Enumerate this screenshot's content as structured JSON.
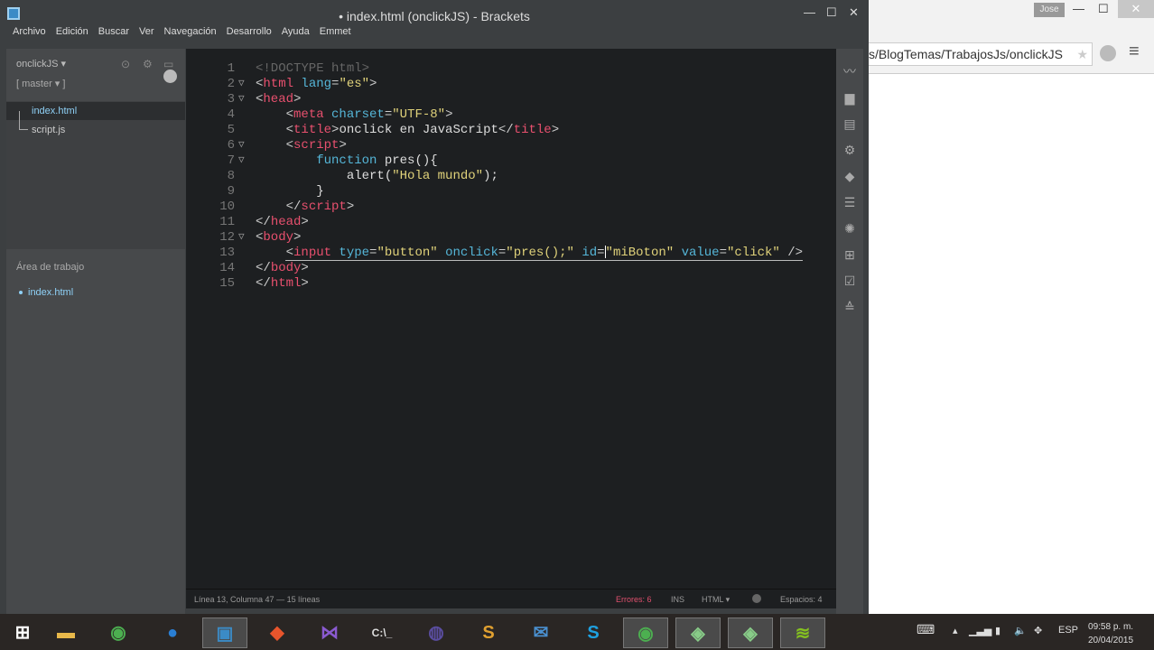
{
  "window": {
    "title": "• index.html (onclickJS) - Brackets",
    "minimize": "—",
    "maximize": "☐",
    "close": "✕"
  },
  "menu": [
    "Archivo",
    "Edición",
    "Buscar",
    "Ver",
    "Navegación",
    "Desarrollo",
    "Ayuda",
    "Emmet"
  ],
  "sidebar": {
    "project": "onclickJS ▾",
    "branch": "[ master ▾ ]",
    "files": [
      "index.html",
      "script.js"
    ],
    "working_set_title": "Área de trabajo",
    "working_set": [
      "index.html"
    ]
  },
  "code": [
    {
      "n": "1",
      "fold": "",
      "t": [
        [
          "com",
          "<!DOCTYPE html>"
        ]
      ]
    },
    {
      "n": "2",
      "fold": "▽",
      "t": [
        [
          "pun",
          "<"
        ],
        [
          "tag",
          "html"
        ],
        [
          "attr",
          " lang"
        ],
        [
          "pun",
          "="
        ],
        [
          "str",
          "\"es\""
        ],
        [
          "pun",
          ">"
        ]
      ]
    },
    {
      "n": "3",
      "fold": "▽",
      "t": [
        [
          "pun",
          "<"
        ],
        [
          "tag",
          "head"
        ],
        [
          "pun",
          ">"
        ]
      ]
    },
    {
      "n": "4",
      "fold": "",
      "t": [
        [
          "txt",
          "    "
        ],
        [
          "pun",
          "<"
        ],
        [
          "tag",
          "meta"
        ],
        [
          "attr",
          " charset"
        ],
        [
          "pun",
          "="
        ],
        [
          "str",
          "\"UTF-8\""
        ],
        [
          "pun",
          ">"
        ]
      ]
    },
    {
      "n": "5",
      "fold": "",
      "t": [
        [
          "txt",
          "    "
        ],
        [
          "pun",
          "<"
        ],
        [
          "tag",
          "title"
        ],
        [
          "pun",
          ">"
        ],
        [
          "txt",
          "onclick en JavaScript"
        ],
        [
          "pun",
          "</"
        ],
        [
          "tag",
          "title"
        ],
        [
          "pun",
          ">"
        ]
      ]
    },
    {
      "n": "6",
      "fold": "▽",
      "t": [
        [
          "txt",
          "    "
        ],
        [
          "pun",
          "<"
        ],
        [
          "tag",
          "script"
        ],
        [
          "pun",
          ">"
        ]
      ]
    },
    {
      "n": "7",
      "fold": "▽",
      "t": [
        [
          "txt",
          "        "
        ],
        [
          "kw",
          "function"
        ],
        [
          "txt",
          " pres(){"
        ]
      ]
    },
    {
      "n": "8",
      "fold": "",
      "t": [
        [
          "txt",
          "            alert("
        ],
        [
          "str",
          "\"Hola mundo\""
        ],
        [
          "txt",
          ");"
        ]
      ]
    },
    {
      "n": "9",
      "fold": "",
      "t": [
        [
          "txt",
          "        }"
        ]
      ]
    },
    {
      "n": "10",
      "fold": "",
      "t": [
        [
          "txt",
          "    "
        ],
        [
          "pun",
          "</"
        ],
        [
          "tag",
          "script"
        ],
        [
          "pun",
          ">"
        ]
      ]
    },
    {
      "n": "11",
      "fold": "",
      "t": [
        [
          "pun",
          "</"
        ],
        [
          "tag",
          "head"
        ],
        [
          "pun",
          ">"
        ]
      ]
    },
    {
      "n": "12",
      "fold": "▽",
      "t": [
        [
          "pun",
          "<"
        ],
        [
          "tag",
          "body"
        ],
        [
          "pun",
          ">"
        ]
      ]
    },
    {
      "n": "13",
      "fold": "",
      "t": [
        [
          "txt",
          "    "
        ],
        [
          "pun",
          "<"
        ],
        [
          "tag",
          "input"
        ],
        [
          "attr",
          " type"
        ],
        [
          "pun",
          "="
        ],
        [
          "str",
          "\"button\""
        ],
        [
          "attr",
          " onclick"
        ],
        [
          "pun",
          "="
        ],
        [
          "str",
          "\"pres();\""
        ],
        [
          "attr",
          " id"
        ],
        [
          "pun",
          "="
        ],
        [
          "cursor",
          ""
        ],
        [
          "str",
          "\"miBoton\""
        ],
        [
          "attr",
          " value"
        ],
        [
          "pun",
          "="
        ],
        [
          "str",
          "\"click\""
        ],
        [
          "pun",
          " />"
        ]
      ]
    },
    {
      "n": "14",
      "fold": "",
      "t": [
        [
          "pun",
          "</"
        ],
        [
          "tag",
          "body"
        ],
        [
          "pun",
          ">"
        ]
      ]
    },
    {
      "n": "15",
      "fold": "",
      "t": [
        [
          "pun",
          "</"
        ],
        [
          "tag",
          "html"
        ],
        [
          "pun",
          ">"
        ]
      ]
    }
  ],
  "status": {
    "position": "Línea 13, Columna 47 — 15 líneas",
    "errors": "Errores: 6",
    "mode": "INS",
    "language": "HTML ▾",
    "spaces": "Espacios: 4"
  },
  "browser": {
    "user": "Jose",
    "url": "s/BlogTemas/TrabajosJs/onclickJS",
    "star": "★",
    "menu": "≡"
  },
  "tray": {
    "lang": "ESP",
    "time": "09:58 p. m.",
    "date": "20/04/2015"
  }
}
